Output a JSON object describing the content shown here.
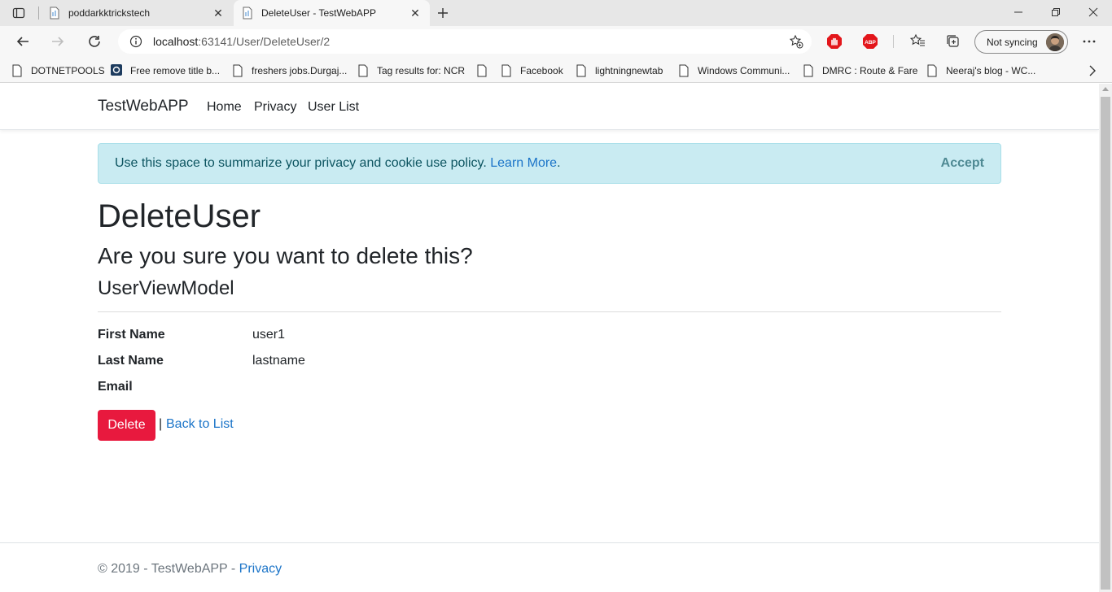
{
  "browser": {
    "tabs": [
      {
        "title": "poddarkktrickstech"
      },
      {
        "title": "DeleteUser - TestWebAPP"
      }
    ],
    "address": {
      "host": "localhost",
      "path": ":63141/User/DeleteUser/2"
    },
    "profile_label": "Not syncing",
    "bookmarks": [
      {
        "label": "DOTNETPOOLS"
      },
      {
        "label": "Free remove title b..."
      },
      {
        "label": "freshers jobs.Durgaj..."
      },
      {
        "label": "Tag results for: NCR"
      },
      {
        "label": ""
      },
      {
        "label": "Facebook"
      },
      {
        "label": "lightningnewtab"
      },
      {
        "label": "Windows Communi..."
      },
      {
        "label": "DMRC : Route & Fare"
      },
      {
        "label": "Neeraj's blog - WC..."
      }
    ],
    "extensions": {
      "abp_label": "ABP"
    }
  },
  "site": {
    "brand": "TestWebAPP",
    "nav": [
      {
        "label": "Home"
      },
      {
        "label": "Privacy"
      },
      {
        "label": "User List"
      }
    ],
    "cookie": {
      "message": "Use this space to summarize your privacy and cookie use policy.",
      "learn_more": "Learn More",
      "period": ".",
      "accept": "Accept"
    }
  },
  "main": {
    "title": "DeleteUser",
    "confirm": "Are you sure you want to delete this?",
    "model": "UserViewModel",
    "fields": [
      {
        "label": "First Name",
        "value": "user1"
      },
      {
        "label": "Last Name",
        "value": "lastname"
      },
      {
        "label": "Email",
        "value": ""
      }
    ],
    "delete_label": "Delete",
    "separator": "|",
    "back_label": "Back to List"
  },
  "footer": {
    "text": "© 2019 - TestWebAPP - ",
    "privacy": "Privacy"
  },
  "colors": {
    "danger": "#e8193e",
    "link": "#1b74c8",
    "alert_bg": "#c9ebf2"
  }
}
